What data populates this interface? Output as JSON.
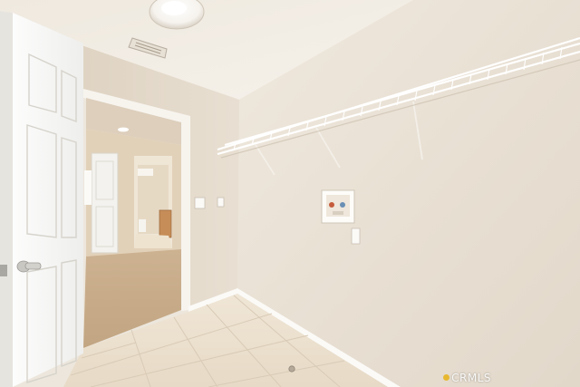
{
  "photo": {
    "subject": "laundry-room",
    "watermark": "CRMLS"
  },
  "colors": {
    "wall_right": "#ebe3d7",
    "wall_left": "#e3d9ca",
    "ceiling": "#f2ede5",
    "tile_floor": "#ece1d0",
    "carpet": "#c9ac8c",
    "door": "#f8f8f6",
    "hall_wall": "#e1d0b8",
    "shelf": "#ffffff",
    "cabinet": "#c8905a"
  }
}
